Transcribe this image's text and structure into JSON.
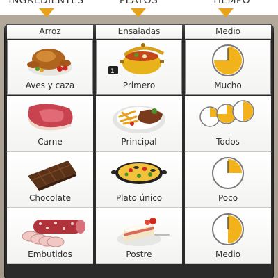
{
  "header": {
    "col1": "INGREDIENTES",
    "col2": "PLATOS",
    "col3": "TIEMPO"
  },
  "columns": {
    "ingredients": {
      "top": "Arroz",
      "items": [
        "Aves y caza",
        "Carne",
        "Chocolate",
        "Embutidos"
      ]
    },
    "dishes": {
      "top": "Ensaladas",
      "items": [
        "Primero",
        "Principal",
        "Plato único",
        "Postre"
      ]
    },
    "time": {
      "top": "Medio",
      "items": [
        "Mucho",
        "Todos",
        "Poco",
        "Medio"
      ]
    }
  },
  "colors": {
    "accent": "#e8a21a",
    "clock_fill": "#f2b21b",
    "panel": "#2b2b2b"
  },
  "icons": {
    "aves": "roast-chicken-icon",
    "carne": "raw-meat-icon",
    "chocolate": "chocolate-bar-icon",
    "embutidos": "sausage-icon",
    "primero": "soup-pot-icon",
    "principal": "steak-plate-icon",
    "unico": "paella-pan-icon",
    "postre": "cake-slice-icon",
    "clock": "clock-icon"
  }
}
